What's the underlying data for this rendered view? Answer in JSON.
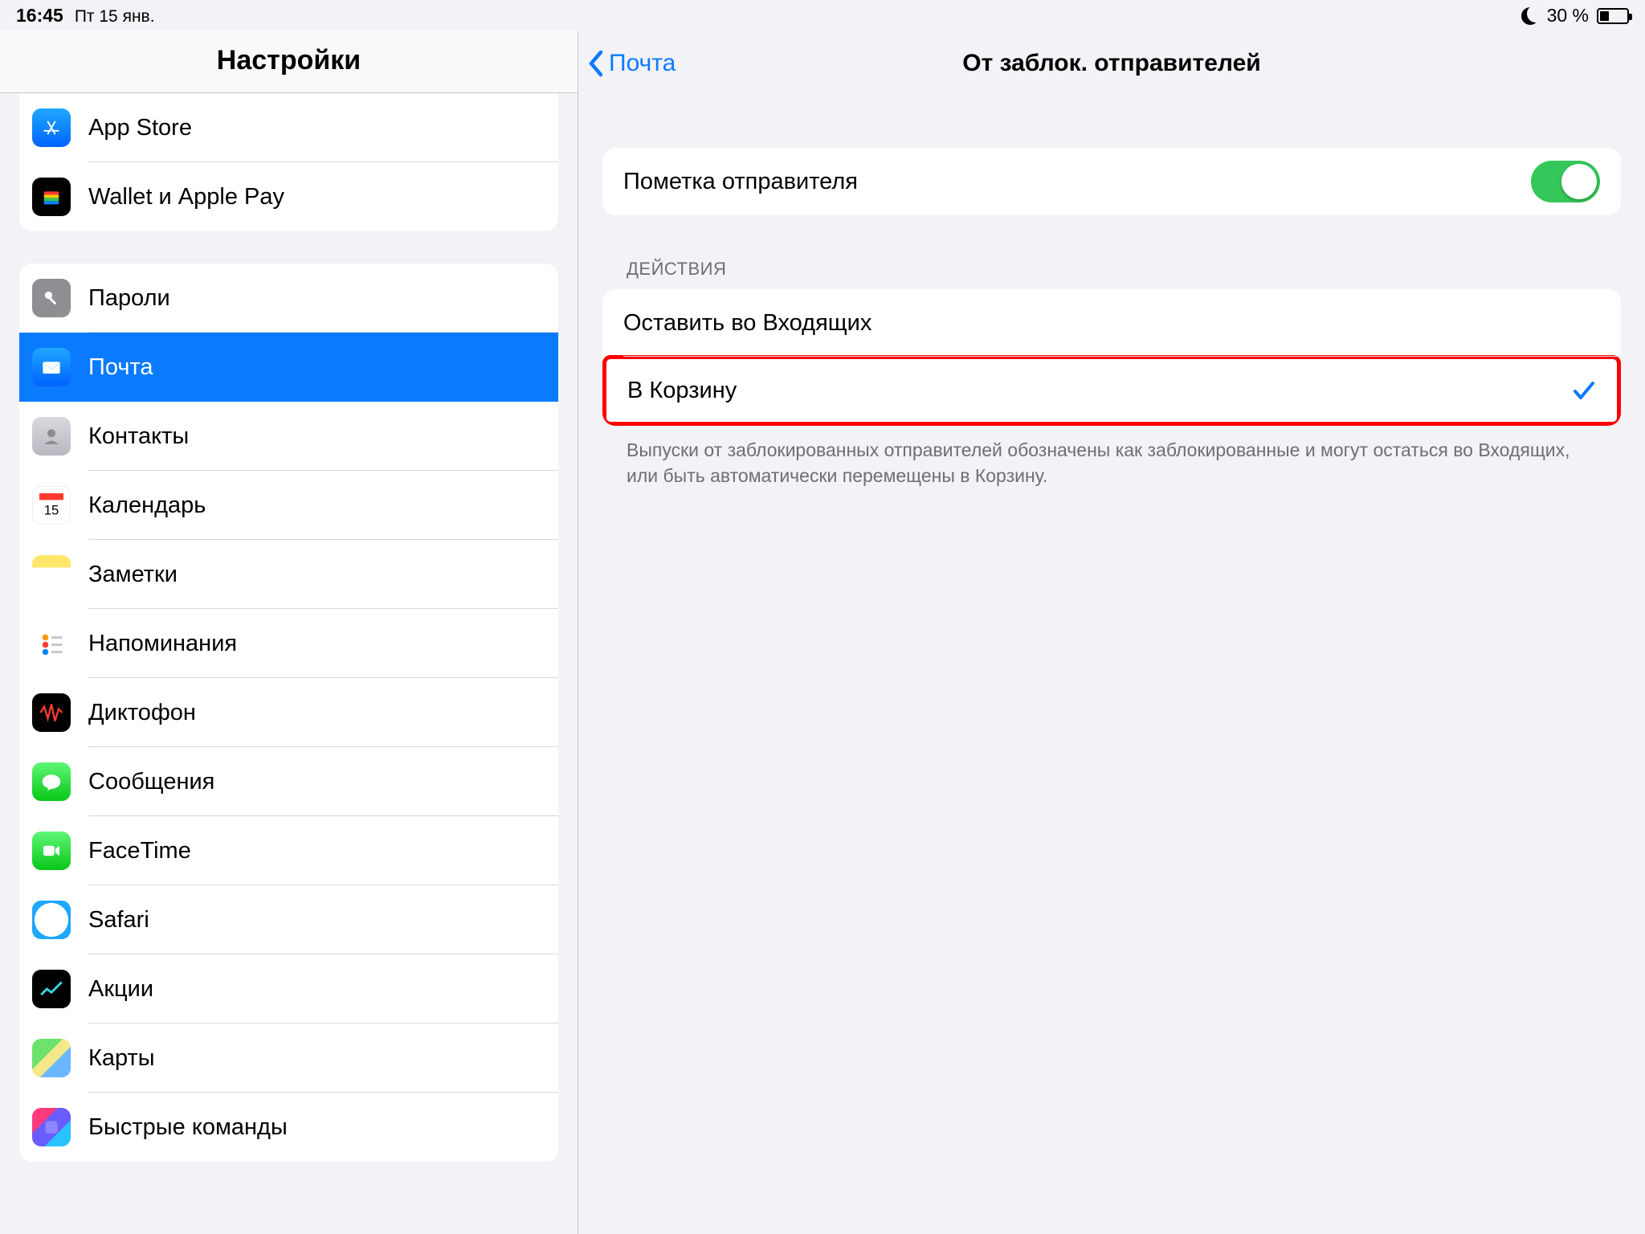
{
  "statusbar": {
    "time": "16:45",
    "date": "Пт 15 янв.",
    "battery": "30 %"
  },
  "sidebar": {
    "title": "Настройки",
    "group1": [
      {
        "label": "App Store"
      },
      {
        "label": "Wallet и Apple Pay"
      }
    ],
    "group2": [
      {
        "label": "Пароли"
      },
      {
        "label": "Почта",
        "selected": true
      },
      {
        "label": "Контакты"
      },
      {
        "label": "Календарь"
      },
      {
        "label": "Заметки"
      },
      {
        "label": "Напоминания"
      },
      {
        "label": "Диктофон"
      },
      {
        "label": "Сообщения"
      },
      {
        "label": "FaceTime"
      },
      {
        "label": "Safari"
      },
      {
        "label": "Акции"
      },
      {
        "label": "Карты"
      },
      {
        "label": "Быстрые команды"
      }
    ]
  },
  "detail": {
    "back": "Почта",
    "title": "От заблок. отправителей",
    "toggle_label": "Пометка отправителя",
    "toggle_on": true,
    "actions_header": "ДЕЙСТВИЯ",
    "actions": [
      {
        "label": "Оставить во Входящих",
        "checked": false
      },
      {
        "label": "В Корзину",
        "checked": true,
        "highlighted": true
      }
    ],
    "footer": "Выпуски от заблокированных отправителей обозначены как заблокированные и могут остаться во Входящих, или быть автоматически перемещены в Корзину."
  }
}
